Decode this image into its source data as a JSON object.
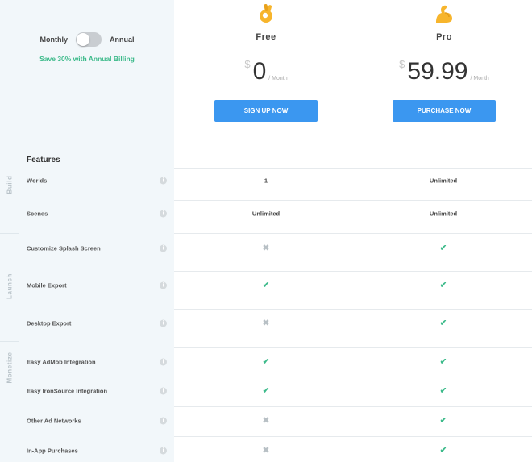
{
  "billing": {
    "monthly_label": "Monthly",
    "annual_label": "Annual",
    "annual_selected": false,
    "save_text": "Save 30% with Annual Billing"
  },
  "features_heading": "Features",
  "groups": [
    "Build",
    "Launch",
    "Monetize"
  ],
  "plans": [
    {
      "name": "Free",
      "icon": "ok-hand-icon",
      "currency": "$",
      "amount": "0",
      "period": "/ Month",
      "cta": "SIGN UP NOW"
    },
    {
      "name": "Pro",
      "icon": "flexed-biceps-icon",
      "currency": "$",
      "amount": "59.99",
      "period": "/ Month",
      "cta": "PURCHASE NOW"
    }
  ],
  "features": [
    {
      "label": "Worlds",
      "group": "Build",
      "free": "1",
      "pro": "Unlimited"
    },
    {
      "label": "Scenes",
      "group": "Build",
      "free": "Unlimited",
      "pro": "Unlimited"
    },
    {
      "label": "Customize Splash Screen",
      "group": "Launch",
      "free": "cross",
      "pro": "check"
    },
    {
      "label": "Mobile Export",
      "group": "Launch",
      "free": "check",
      "pro": "check"
    },
    {
      "label": "Desktop Export",
      "group": "Launch",
      "free": "cross",
      "pro": "check"
    },
    {
      "label": "Easy AdMob Integration",
      "group": "Monetize",
      "free": "check",
      "pro": "check"
    },
    {
      "label": "Easy IronSource Integration",
      "group": "Monetize",
      "free": "check",
      "pro": "check"
    },
    {
      "label": "Other Ad Networks",
      "group": "Monetize",
      "free": "cross",
      "pro": "check"
    },
    {
      "label": "In-App Purchases",
      "group": "Monetize",
      "free": "cross",
      "pro": "check"
    }
  ],
  "colors": {
    "accent_button": "#3b97f0",
    "check": "#3cba8a",
    "cross": "#b8c0c5",
    "sidebar_bg": "#f2f7fa"
  }
}
